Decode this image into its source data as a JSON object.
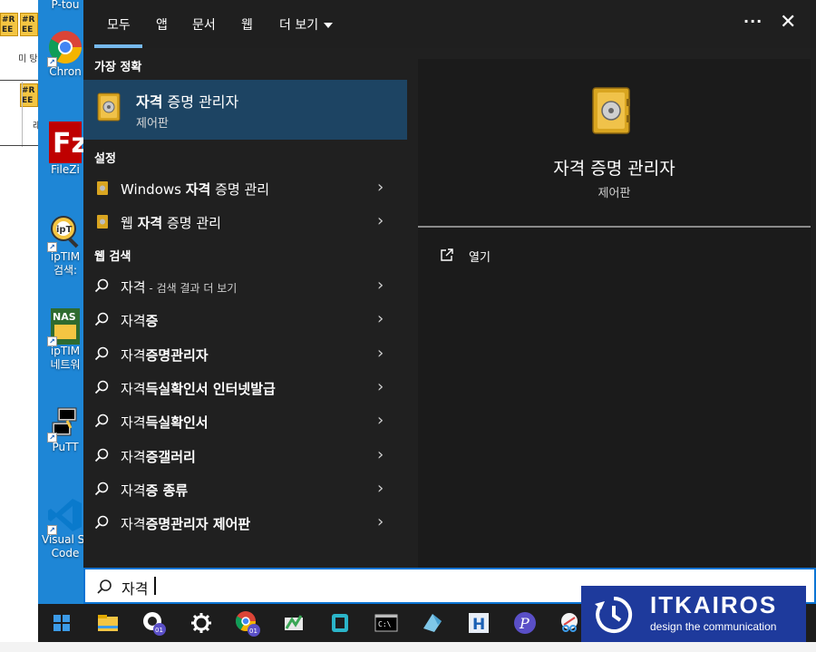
{
  "spreadsheet": {
    "cells": [
      "#R EE",
      "#R EE",
      "#R EE"
    ],
    "text_1": "미 탕",
    "text_2": "래"
  },
  "desktop": {
    "icons": [
      {
        "label_1": "P-tou",
        "label_2": "",
        "icon": "ptouch-icon"
      },
      {
        "label_1": "Chron",
        "label_2": "",
        "icon": "chrome-icon"
      },
      {
        "label_1": "FileZi",
        "label_2": "",
        "icon": "filezilla-icon"
      },
      {
        "label_1": "ipTIM",
        "label_2": "검색:",
        "icon": "iptime-search-icon"
      },
      {
        "label_1": "ipTIM",
        "label_2": "네트워",
        "icon": "iptime-nas-icon"
      },
      {
        "label_1": "PuTT",
        "label_2": "",
        "icon": "putty-icon"
      },
      {
        "label_1": "Visual St",
        "label_2": "Code",
        "icon": "vscode-icon"
      }
    ]
  },
  "tabs": {
    "all": "모두",
    "apps": "앱",
    "documents": "문서",
    "web": "웹",
    "more": "더 보기",
    "ellipsis": "···",
    "close": "✕"
  },
  "best_match": {
    "heading": "가장 정확",
    "title_bold": "자격",
    "title_rest": " 증명 관리자",
    "subtitle": "제어판"
  },
  "settings": {
    "heading": "설정",
    "items": [
      {
        "pre": "Windows ",
        "bold": "자격",
        "post": " 증명 관리"
      },
      {
        "pre": "웹 ",
        "bold": "자격",
        "post": " 증명 관리"
      }
    ]
  },
  "web_search": {
    "heading": "웹 검색",
    "items": [
      {
        "pre": "자격",
        "bold": "",
        "dim": " - 검색 결과 더 보기"
      },
      {
        "pre": "자격",
        "bold": "증",
        "dim": ""
      },
      {
        "pre": "자격",
        "bold": "증명관리자",
        "dim": ""
      },
      {
        "pre": "자격",
        "bold": "득실확인서 인터넷발급",
        "dim": ""
      },
      {
        "pre": "자격",
        "bold": "득실확인서",
        "dim": ""
      },
      {
        "pre": "자격",
        "bold": "증갤러리",
        "dim": ""
      },
      {
        "pre": "자격",
        "bold": "증 종류",
        "dim": ""
      },
      {
        "pre": "자격",
        "bold": "증명관리자 제어판",
        "dim": ""
      }
    ]
  },
  "preview": {
    "title": "자격 증명 관리자",
    "subtitle": "제어판",
    "open_label": "열기"
  },
  "search": {
    "query": "자격"
  },
  "taskbar": {
    "items": [
      "start-icon",
      "file-explorer-icon",
      "chrome-profile-icon",
      "settings-icon",
      "chrome-icon",
      "app-icon",
      "app-icon",
      "terminal-icon",
      "app-icon",
      "h-app-icon",
      "p-app-icon",
      "snip-icon"
    ]
  },
  "logo": {
    "name": "ITKAIROS",
    "tagline": "design the communication"
  },
  "colors": {
    "accent": "#76b9ed",
    "selected": "#1d4463",
    "panel": "#202020",
    "logo_bg": "#1e3a9c",
    "search_border": "#0a74d4"
  }
}
